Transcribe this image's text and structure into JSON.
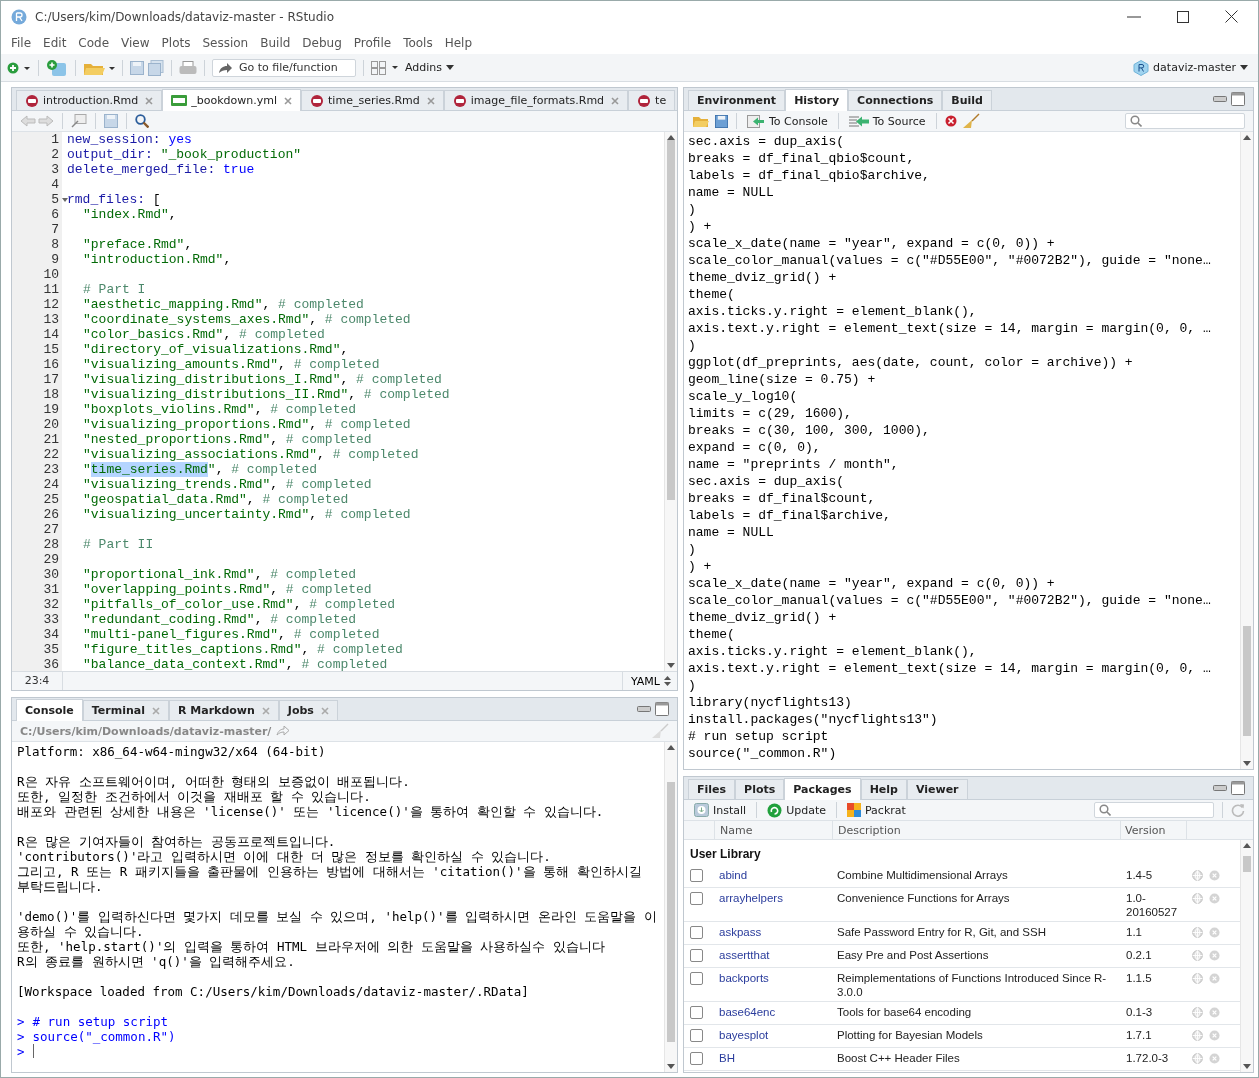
{
  "window": {
    "title": "C:/Users/kim/Downloads/dataviz-master - RStudio"
  },
  "menu": [
    "File",
    "Edit",
    "Code",
    "View",
    "Plots",
    "Session",
    "Build",
    "Debug",
    "Profile",
    "Tools",
    "Help"
  ],
  "toolbar": {
    "goto_placeholder": "Go to file/function",
    "addins": "Addins",
    "project": "dataviz-master"
  },
  "editor": {
    "tabs": [
      {
        "label": "introduction.Rmd",
        "kind": "rmd",
        "selected": false
      },
      {
        "label": "_bookdown.yml",
        "kind": "yml",
        "selected": true
      },
      {
        "label": "time_series.Rmd",
        "kind": "rmd",
        "selected": false
      },
      {
        "label": "image_file_formats.Rmd",
        "kind": "rmd",
        "selected": false
      },
      {
        "label": "te",
        "kind": "rmd",
        "selected": false
      }
    ],
    "lines": [
      {
        "n": "1",
        "code": [
          {
            "kind": "key",
            "text": "new_session: "
          },
          {
            "kind": "value",
            "text": "yes"
          }
        ]
      },
      {
        "n": "2",
        "code": [
          {
            "kind": "key",
            "text": "output_dir: "
          },
          {
            "kind": "string",
            "text": "\"_book_production\""
          }
        ]
      },
      {
        "n": "3",
        "code": [
          {
            "kind": "key",
            "text": "delete_merged_file: "
          },
          {
            "kind": "value",
            "text": "true"
          }
        ]
      },
      {
        "n": "4"
      },
      {
        "n": "5",
        "fold": true,
        "code": [
          {
            "kind": "key",
            "text": "rmd_files: "
          },
          {
            "kind": "text",
            "text": "["
          }
        ]
      },
      {
        "n": "6",
        "indented": true,
        "code": [
          {
            "kind": "string",
            "text": "\"index.Rmd\""
          },
          {
            "kind": "text",
            "text": ","
          }
        ]
      },
      {
        "n": "7"
      },
      {
        "n": "8",
        "indented": true,
        "code": [
          {
            "kind": "string",
            "text": "\"preface.Rmd\""
          },
          {
            "kind": "text",
            "text": ","
          }
        ]
      },
      {
        "n": "9",
        "indented": true,
        "code": [
          {
            "kind": "string",
            "text": "\"introduction.Rmd\""
          },
          {
            "kind": "text",
            "text": ","
          }
        ]
      },
      {
        "n": "10"
      },
      {
        "n": "11",
        "indented": true,
        "code": [
          {
            "kind": "comment",
            "text": "# Part I"
          }
        ]
      },
      {
        "n": "12",
        "indented": true,
        "code": [
          {
            "kind": "string",
            "text": "\"aesthetic_mapping.Rmd\""
          },
          {
            "kind": "text",
            "text": ", "
          },
          {
            "kind": "comment",
            "text": "# completed"
          }
        ]
      },
      {
        "n": "13",
        "indented": true,
        "code": [
          {
            "kind": "string",
            "text": "\"coordinate_systems_axes.Rmd\""
          },
          {
            "kind": "text",
            "text": ", "
          },
          {
            "kind": "comment",
            "text": "# completed"
          }
        ]
      },
      {
        "n": "14",
        "indented": true,
        "code": [
          {
            "kind": "string",
            "text": "\"color_basics.Rmd\""
          },
          {
            "kind": "text",
            "text": ", "
          },
          {
            "kind": "comment",
            "text": "# completed"
          }
        ]
      },
      {
        "n": "15",
        "indented": true,
        "code": [
          {
            "kind": "string",
            "text": "\"directory_of_visualizations.Rmd\""
          },
          {
            "kind": "text",
            "text": ","
          }
        ]
      },
      {
        "n": "16",
        "indented": true,
        "code": [
          {
            "kind": "string",
            "text": "\"visualizing_amounts.Rmd\""
          },
          {
            "kind": "text",
            "text": ", "
          },
          {
            "kind": "comment",
            "text": "# completed"
          }
        ]
      },
      {
        "n": "17",
        "indented": true,
        "code": [
          {
            "kind": "string",
            "text": "\"visualizing_distributions_I.Rmd\""
          },
          {
            "kind": "text",
            "text": ", "
          },
          {
            "kind": "comment",
            "text": "# completed"
          }
        ]
      },
      {
        "n": "18",
        "indented": true,
        "code": [
          {
            "kind": "string",
            "text": "\"visualizing_distributions_II.Rmd\""
          },
          {
            "kind": "text",
            "text": ", "
          },
          {
            "kind": "comment",
            "text": "# completed"
          }
        ]
      },
      {
        "n": "19",
        "indented": true,
        "code": [
          {
            "kind": "string",
            "text": "\"boxplots_violins.Rmd\""
          },
          {
            "kind": "text",
            "text": ", "
          },
          {
            "kind": "comment",
            "text": "# completed"
          }
        ]
      },
      {
        "n": "20",
        "indented": true,
        "code": [
          {
            "kind": "string",
            "text": "\"visualizing_proportions.Rmd\""
          },
          {
            "kind": "text",
            "text": ", "
          },
          {
            "kind": "comment",
            "text": "# completed"
          }
        ]
      },
      {
        "n": "21",
        "indented": true,
        "code": [
          {
            "kind": "string",
            "text": "\"nested_proportions.Rmd\""
          },
          {
            "kind": "text",
            "text": ", "
          },
          {
            "kind": "comment",
            "text": "# completed"
          }
        ]
      },
      {
        "n": "22",
        "indented": true,
        "code": [
          {
            "kind": "string",
            "text": "\"visualizing_associations.Rmd\""
          },
          {
            "kind": "text",
            "text": ", "
          },
          {
            "kind": "comment",
            "text": "# completed"
          }
        ]
      },
      {
        "n": "23",
        "indented": true,
        "code": [
          {
            "kind": "string",
            "text": "\""
          },
          {
            "kind": "selected",
            "text": "time_series.Rmd"
          },
          {
            "kind": "string",
            "text": "\""
          },
          {
            "kind": "text",
            "text": ", "
          },
          {
            "kind": "comment",
            "text": "# completed"
          }
        ]
      },
      {
        "n": "24",
        "indented": true,
        "code": [
          {
            "kind": "string",
            "text": "\"visualizing_trends.Rmd\""
          },
          {
            "kind": "text",
            "text": ", "
          },
          {
            "kind": "comment",
            "text": "# completed"
          }
        ]
      },
      {
        "n": "25",
        "indented": true,
        "code": [
          {
            "kind": "string",
            "text": "\"geospatial_data.Rmd\""
          },
          {
            "kind": "text",
            "text": ", "
          },
          {
            "kind": "comment",
            "text": "# completed"
          }
        ]
      },
      {
        "n": "26",
        "indented": true,
        "code": [
          {
            "kind": "string",
            "text": "\"visualizing_uncertainty.Rmd\""
          },
          {
            "kind": "text",
            "text": ", "
          },
          {
            "kind": "comment",
            "text": "# completed"
          }
        ]
      },
      {
        "n": "27"
      },
      {
        "n": "28",
        "indented": true,
        "code": [
          {
            "kind": "comment",
            "text": "# Part II"
          }
        ]
      },
      {
        "n": "29"
      },
      {
        "n": "30",
        "indented": true,
        "code": [
          {
            "kind": "string",
            "text": "\"proportional_ink.Rmd\""
          },
          {
            "kind": "text",
            "text": ", "
          },
          {
            "kind": "comment",
            "text": "# completed"
          }
        ]
      },
      {
        "n": "31",
        "indented": true,
        "code": [
          {
            "kind": "string",
            "text": "\"overlapping_points.Rmd\""
          },
          {
            "kind": "text",
            "text": ", "
          },
          {
            "kind": "comment",
            "text": "# completed"
          }
        ]
      },
      {
        "n": "32",
        "indented": true,
        "code": [
          {
            "kind": "string",
            "text": "\"pitfalls_of_color_use.Rmd\""
          },
          {
            "kind": "text",
            "text": ", "
          },
          {
            "kind": "comment",
            "text": "# completed"
          }
        ]
      },
      {
        "n": "33",
        "indented": true,
        "code": [
          {
            "kind": "string",
            "text": "\"redundant_coding.Rmd\""
          },
          {
            "kind": "text",
            "text": ", "
          },
          {
            "kind": "comment",
            "text": "# completed"
          }
        ]
      },
      {
        "n": "34",
        "indented": true,
        "code": [
          {
            "kind": "string",
            "text": "\"multi-panel_figures.Rmd\""
          },
          {
            "kind": "text",
            "text": ", "
          },
          {
            "kind": "comment",
            "text": "# completed"
          }
        ]
      },
      {
        "n": "35",
        "indented": true,
        "code": [
          {
            "kind": "string",
            "text": "\"figure_titles_captions.Rmd\""
          },
          {
            "kind": "text",
            "text": ", "
          },
          {
            "kind": "comment",
            "text": "# completed"
          }
        ]
      },
      {
        "n": "36",
        "indented": true,
        "code": [
          {
            "kind": "string",
            "text": "\"balance_data_context.Rmd\""
          },
          {
            "kind": "text",
            "text": ", "
          },
          {
            "kind": "comment",
            "text": "# completed"
          }
        ]
      }
    ],
    "status": {
      "position": "23:4",
      "mode": "YAML"
    }
  },
  "console": {
    "tabs": [
      {
        "label": "Console",
        "closable": false,
        "selected": true
      },
      {
        "label": "Terminal",
        "closable": true,
        "selected": false
      },
      {
        "label": "R Markdown",
        "closable": true,
        "selected": false
      },
      {
        "label": "Jobs",
        "closable": true,
        "selected": false
      }
    ],
    "path": "C:/Users/kim/Downloads/dataviz-master/",
    "paragraphs": [
      [
        "Platform: x86_64-w64-mingw32/x64 (64-bit)"
      ],
      [
        "R은 자유 소프트웨어이며, 어떠한 형태의 보증없이 배포됩니다.",
        "또한, 일정한 조건하에서 이것을 재배포 할 수 있습니다.",
        "배포와 관련된 상세한 내용은 'license()' 또는 'licence()'을 통하여 확인할 수 있습니다."
      ],
      [
        "R은 많은 기여자들이 참여하는 공동프로젝트입니다.",
        "'contributors()'라고 입력하시면 이에 대한 더 많은 정보를 확인하실 수 있습니다.",
        "그리고, R 또는 R 패키지들을 출판물에 인용하는 방법에 대해서는 'citation()'을 통해 확인하시길 부탁드립니다."
      ],
      [
        "'demo()'를 입력하신다면 몇가지 데모를 보실 수 있으며, 'help()'를 입력하시면 온라인 도움말을 이용하실 수 있습니다.",
        "또한, 'help.start()'의 입력을 통하여 HTML 브라우저에 의한 도움말을 사용하실수 있습니다",
        "R의 종료를 원하시면 'q()'을 입력해주세요."
      ],
      [
        "[Workspace loaded from C:/Users/kim/Downloads/dataviz-master/.RData]"
      ]
    ],
    "commands": [
      "# run setup script",
      "source(\"_common.R\")"
    ],
    "prompt": ">"
  },
  "history": {
    "tabs": [
      {
        "label": "Environment",
        "selected": false
      },
      {
        "label": "History",
        "selected": true
      },
      {
        "label": "Connections",
        "selected": false
      },
      {
        "label": "Build",
        "selected": false
      }
    ],
    "to_console": "To Console",
    "to_source": "To Source",
    "lines": [
      "sec.axis = dup_axis(",
      "breaks = df_final_qbio$count,",
      "labels = df_final_qbio$archive,",
      "name = NULL",
      ")",
      ") +",
      "scale_x_date(name = \"year\", expand = c(0, 0)) +",
      "scale_color_manual(values = c(\"#D55E00\", \"#0072B2\"), guide = \"none…",
      "theme_dviz_grid() +",
      "theme(",
      "axis.ticks.y.right = element_blank(),",
      "axis.text.y.right = element_text(size = 14, margin = margin(0, 0, …",
      ")",
      "ggplot(df_preprints, aes(date, count, color = archive)) +",
      "geom_line(size = 0.75) +",
      "scale_y_log10(",
      "limits = c(29, 1600),",
      "breaks = c(30, 100, 300, 1000),",
      "expand = c(0, 0),",
      "name = \"preprints / month\",",
      "sec.axis = dup_axis(",
      "breaks = df_final$count,",
      "labels = df_final$archive,",
      "name = NULL",
      ")",
      ") +",
      "scale_x_date(name = \"year\", expand = c(0, 0)) +",
      "scale_color_manual(values = c(\"#D55E00\", \"#0072B2\"), guide = \"none…",
      "theme_dviz_grid() +",
      "theme(",
      "axis.ticks.y.right = element_blank(),",
      "axis.text.y.right = element_text(size = 14, margin = margin(0, 0, …",
      ")",
      "library(nycflights13)",
      "install.packages(\"nycflights13\")",
      "# run setup script",
      "source(\"_common.R\")"
    ]
  },
  "packages": {
    "tabs": [
      {
        "label": "Files",
        "selected": false
      },
      {
        "label": "Plots",
        "selected": false
      },
      {
        "label": "Packages",
        "selected": true
      },
      {
        "label": "Help",
        "selected": false
      },
      {
        "label": "Viewer",
        "selected": false
      }
    ],
    "install": "Install",
    "update": "Update",
    "packrat": "Packrat",
    "columns": [
      "Name",
      "Description",
      "Version"
    ],
    "library": "User Library",
    "rows": [
      {
        "name": "abind",
        "description": "Combine Multidimensional Arrays",
        "version": "1.4-5",
        "checked": false
      },
      {
        "name": "arrayhelpers",
        "description": "Convenience Functions for Arrays",
        "version": "1.0-20160527",
        "checked": false
      },
      {
        "name": "askpass",
        "description": "Safe Password Entry for R, Git, and SSH",
        "version": "1.1",
        "checked": false
      },
      {
        "name": "assertthat",
        "description": "Easy Pre and Post Assertions",
        "version": "0.2.1",
        "checked": false
      },
      {
        "name": "backports",
        "description": "Reimplementations of Functions Introduced Since R-3.0.0",
        "version": "1.1.5",
        "checked": false
      },
      {
        "name": "base64enc",
        "description": "Tools for base64 encoding",
        "version": "0.1-3",
        "checked": false
      },
      {
        "name": "bayesplot",
        "description": "Plotting for Bayesian Models",
        "version": "1.7.1",
        "checked": false
      },
      {
        "name": "BH",
        "description": "Boost C++ Header Files",
        "version": "1.72.0-3",
        "checked": false
      }
    ]
  }
}
